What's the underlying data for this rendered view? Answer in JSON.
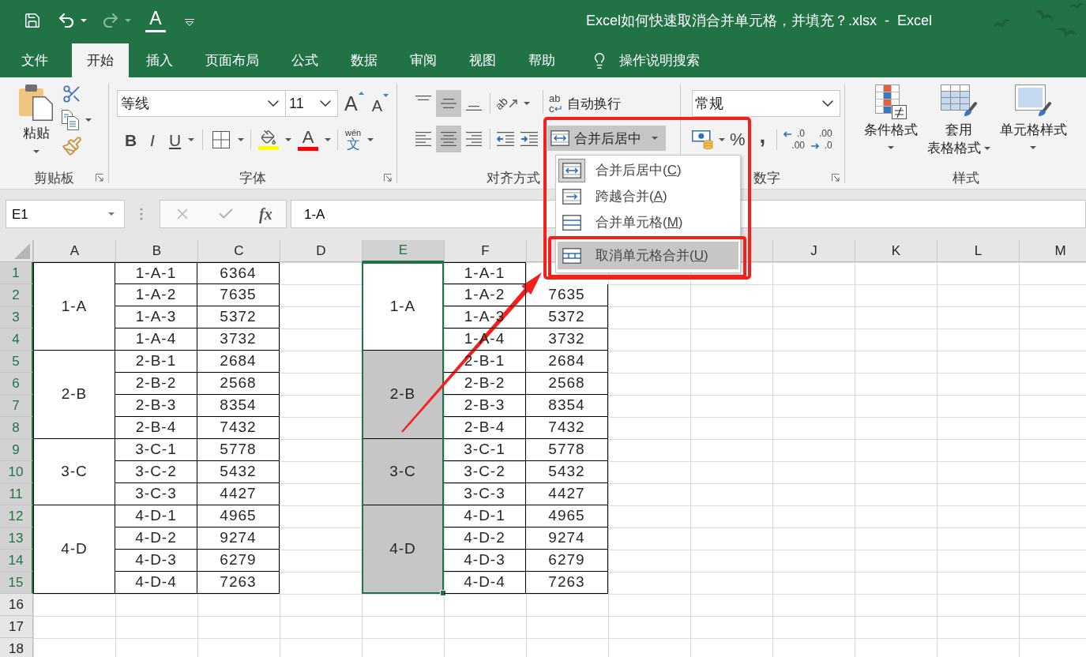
{
  "title_bar": {
    "font_color_glyph": "A",
    "title": "Excel如何快速取消合并单元格，并填充？.xlsx  -  Excel"
  },
  "tabs": [
    {
      "label": "文件",
      "selected": false
    },
    {
      "label": "开始",
      "selected": true
    },
    {
      "label": "插入",
      "selected": false
    },
    {
      "label": "页面布局",
      "selected": false
    },
    {
      "label": "公式",
      "selected": false
    },
    {
      "label": "数据",
      "selected": false
    },
    {
      "label": "审阅",
      "selected": false
    },
    {
      "label": "视图",
      "selected": false
    },
    {
      "label": "帮助",
      "selected": false
    }
  ],
  "tell_me": {
    "label": "操作说明搜索"
  },
  "clipboard": {
    "paste": "粘贴",
    "group_label": "剪贴板"
  },
  "font": {
    "font_name": "等线",
    "font_size": "11",
    "grow": "A",
    "shrink": "A",
    "styles": [
      {
        "kind": "bold",
        "glyph": "B"
      },
      {
        "kind": "italic",
        "glyph": "I"
      },
      {
        "kind": "underline",
        "glyph": "U"
      }
    ],
    "font_color": "A",
    "phonetic": {
      "reading": "wén",
      "character": "文"
    },
    "group_label": "字体"
  },
  "alignment": {
    "vertical": [
      {
        "kind": "top",
        "selected": false
      },
      {
        "kind": "middle",
        "selected": true
      },
      {
        "kind": "bottom",
        "selected": false
      }
    ],
    "orientation": "ab",
    "horizontal": [
      {
        "kind": "left",
        "selected": false
      },
      {
        "kind": "center",
        "selected": true
      },
      {
        "kind": "right",
        "selected": false
      }
    ],
    "wrap_text": {
      "glyph_top": "ab",
      "glyph_bottom": "c",
      "label": "自动换行"
    },
    "merge": {
      "label": "合并后居中",
      "expanded": true
    },
    "group_label": "对齐方式"
  },
  "number": {
    "format": "常规",
    "percent": "%",
    "comma": ",",
    "decimals": [
      {
        "kind": "increase",
        "top": ".0",
        "bottom": ".00"
      },
      {
        "kind": "decrease",
        "top": ".00",
        "bottom": ".0"
      }
    ],
    "group_label": "数字"
  },
  "styles": {
    "buttons": [
      {
        "kind": "conditional",
        "lines": [
          "条件格式"
        ]
      },
      {
        "kind": "table",
        "lines": [
          "套用",
          "表格格式"
        ]
      },
      {
        "kind": "cell",
        "lines": [
          "单元格样式"
        ]
      }
    ],
    "group_label": "样式"
  },
  "merge_menu": [
    {
      "kind": "merge_center",
      "text": "合并后居中(",
      "key": "C",
      "end": ")",
      "checked": true,
      "selected": false
    },
    {
      "kind": "merge_across",
      "text": "跨越合并(",
      "key": "A",
      "end": ")",
      "checked": false,
      "selected": false
    },
    {
      "kind": "merge_cells",
      "text": "合并单元格(",
      "key": "M",
      "end": ")",
      "checked": false,
      "selected": false
    },
    {
      "kind": "unmerge",
      "text": "取消单元格合并(",
      "key": "U",
      "end": ")",
      "checked": false,
      "selected": true
    }
  ],
  "formula_bar": {
    "name_box": "E1",
    "fx": "fx",
    "value": "1-A"
  },
  "sheet": {
    "columns": [
      {
        "label": "A",
        "selected": false
      },
      {
        "label": "B",
        "selected": false
      },
      {
        "label": "C",
        "selected": false
      },
      {
        "label": "D",
        "selected": false
      },
      {
        "label": "E",
        "selected": true
      },
      {
        "label": "F",
        "selected": false
      }
    ],
    "columns_right": [
      {
        "label": "J",
        "selected": false
      },
      {
        "label": "K",
        "selected": false
      },
      {
        "label": "L",
        "selected": false
      },
      {
        "label": "M",
        "selected": false
      }
    ],
    "rows": [
      {
        "label": "1",
        "selected": true
      },
      {
        "label": "2",
        "selected": true
      },
      {
        "label": "3",
        "selected": true
      },
      {
        "label": "4",
        "selected": true
      },
      {
        "label": "5",
        "selected": true
      },
      {
        "label": "6",
        "selected": true
      },
      {
        "label": "7",
        "selected": true
      },
      {
        "label": "8",
        "selected": true
      },
      {
        "label": "9",
        "selected": true
      },
      {
        "label": "10",
        "selected": true
      },
      {
        "label": "11",
        "selected": true
      },
      {
        "label": "12",
        "selected": true
      },
      {
        "label": "13",
        "selected": true
      },
      {
        "label": "14",
        "selected": true
      },
      {
        "label": "15",
        "selected": true
      },
      {
        "label": "16",
        "selected": false
      },
      {
        "label": "17",
        "selected": false
      },
      {
        "label": "18",
        "selected": false
      }
    ],
    "left_table": [
      {
        "group": "1-A",
        "items": [
          {
            "code": "1-A-1",
            "value": "6364"
          },
          {
            "code": "1-A-2",
            "value": "7635"
          },
          {
            "code": "1-A-3",
            "value": "5372"
          },
          {
            "code": "1-A-4",
            "value": "3732"
          }
        ]
      },
      {
        "group": "2-B",
        "items": [
          {
            "code": "2-B-1",
            "value": "2684"
          },
          {
            "code": "2-B-2",
            "value": "2568"
          },
          {
            "code": "2-B-3",
            "value": "8354"
          },
          {
            "code": "2-B-4",
            "value": "7432"
          }
        ]
      },
      {
        "group": "3-C",
        "items": [
          {
            "code": "3-C-1",
            "value": "5778"
          },
          {
            "code": "3-C-2",
            "value": "5432"
          },
          {
            "code": "3-C-3",
            "value": "4427"
          }
        ]
      },
      {
        "group": "4-D",
        "items": [
          {
            "code": "4-D-1",
            "value": "4965"
          },
          {
            "code": "4-D-2",
            "value": "9274"
          },
          {
            "code": "4-D-3",
            "value": "6279"
          },
          {
            "code": "4-D-4",
            "value": "7263"
          }
        ]
      }
    ],
    "right_table": [
      {
        "group": "1-A",
        "active": true,
        "items": [
          {
            "code": "1-A-1"
          },
          {
            "code": "1-A-2",
            "value": "7635"
          },
          {
            "code": "1-A-3",
            "value": "5372"
          },
          {
            "code": "1-A-4",
            "value": "3732"
          }
        ]
      },
      {
        "group": "2-B",
        "active": false,
        "items": [
          {
            "code": "2-B-1",
            "value": "2684"
          },
          {
            "code": "2-B-2",
            "value": "2568"
          },
          {
            "code": "2-B-3",
            "value": "8354"
          },
          {
            "code": "2-B-4",
            "value": "7432"
          }
        ]
      },
      {
        "group": "3-C",
        "active": false,
        "items": [
          {
            "code": "3-C-1",
            "value": "5778"
          },
          {
            "code": "3-C-2",
            "value": "5432"
          },
          {
            "code": "3-C-3",
            "value": "4427"
          }
        ]
      },
      {
        "group": "4-D",
        "active": false,
        "items": [
          {
            "code": "4-D-1",
            "value": "4965"
          },
          {
            "code": "4-D-2",
            "value": "9274"
          },
          {
            "code": "4-D-3",
            "value": "6279"
          },
          {
            "code": "4-D-4",
            "value": "7263"
          }
        ]
      }
    ]
  }
}
